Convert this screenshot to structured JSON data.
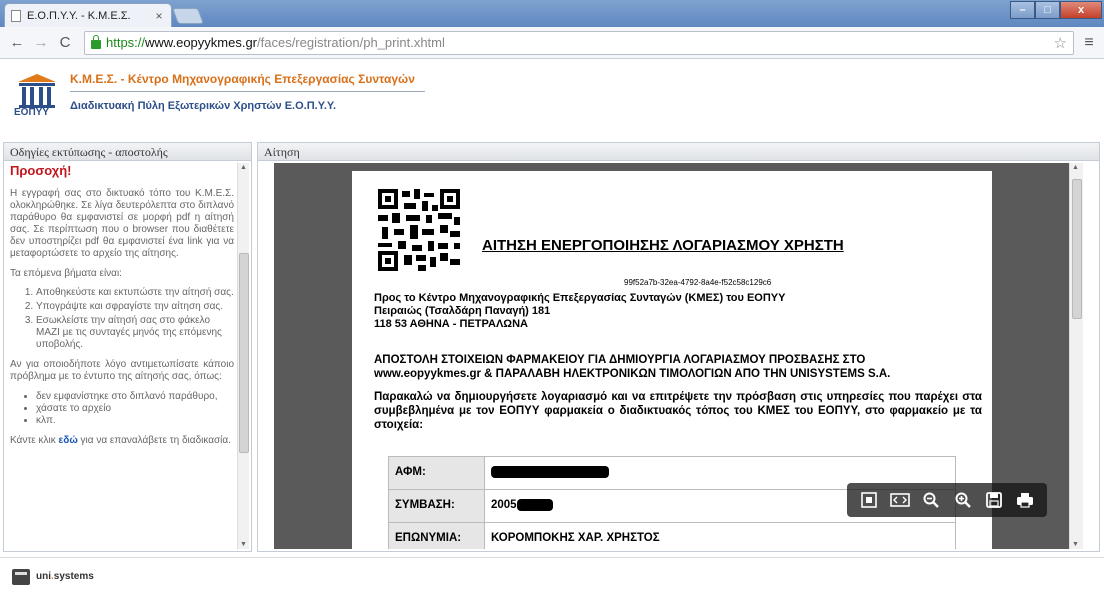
{
  "browser": {
    "tab_title": "Ε.Ο.Π.Υ.Υ. - Κ.Μ.Ε.Σ.",
    "tab_close": "×",
    "url_scheme": "https://",
    "url_host": "www.eopyykmes.gr",
    "url_path": "/faces/registration/ph_print.xhtml",
    "win_min": "–",
    "win_max": "□",
    "win_close": "x"
  },
  "header": {
    "logo_text": "ΕΟΠΥΥ",
    "title": "Κ.Μ.Ε.Σ. - Κέντρο Μηχανογραφικής Επεξεργασίας Συνταγών",
    "subtitle": "Διαδικτυακή Πύλη Εξωτερικών Χρηστών Ε.Ο.Π.Υ.Υ."
  },
  "left_panel": {
    "heading": "Οδηγίες εκτύπωσης - αποστολής",
    "warning": "Προσοχή!",
    "intro": "Η εγγραφή σας στο δικτυακό τόπο του Κ.Μ.Ε.Σ. ολοκληρώθηκε. Σε λίγα δευτερόλεπτα στο διπλανό παράθυρο θα εμφανιστεί σε μορφή pdf η αίτησή σας. Σε περίπτωση που ο browser που διαθέτετε δεν υποστηρίζει pdf θα εμφανιστεί ένα link για να μεταφορτώσετε το αρχείο της αίτησης.",
    "steps_title": "Τα επόμενα βήματα είναι:",
    "steps": [
      "Αποθηκεύστε και εκτυπώστε την αίτησή σας.",
      "Υπογράψτε και σφραγίστε την αίτηση σας.",
      "Εσωκλείστε την αίτησή σας στο φάκελο ΜΑΖΙ με τις συνταγές μηνός της επόμενης υποβολής."
    ],
    "problem_text": "Αν για οποιοδήποτε λόγο αντιμετωπίσατε κάποιο πρόβλημα με το έντυπο της αίτησής σας, όπως:",
    "problems": [
      "δεν εμφανίστηκε στο διπλανό παράθυρο,",
      "χάσατε το αρχείο",
      "κλπ."
    ],
    "retry_prefix": "Κάντε κλικ ",
    "retry_link": "εδώ",
    "retry_suffix": " για να επαναλάβετε τη διαδικασία."
  },
  "right_panel": {
    "heading": "Αίτηση"
  },
  "document": {
    "title": "ΑΙΤΗΣΗ ΕΝΕΡΓΟΠΟΙΗΣΗΣ ΛΟΓΑΡΙΑΣΜΟΥ ΧΡΗΣΤΗ",
    "uuid": "99f52a7b-32ea-4792-8a4e-f52c58c129c6",
    "address_line1": "Προς το Κέντρο Μηχανογραφικής Επεξεργασίας Συνταγών (ΚΜΕΣ) του ΕΟΠΥΥ",
    "address_line2": "Πειραιώς (Τσαλδάρη Παναγή) 181",
    "address_line3": "118 53 ΑΘΗΝΑ - ΠΕΤΡΑΛΩΝΑ",
    "subject_line1": "ΑΠΟΣΤΟΛΗ ΣΤΟΙΧΕΙΩΝ ΦΑΡΜΑΚΕΙΟΥ ΓΙΑ ΔΗΜΙΟΥΡΓΙΑ ΛΟΓΑΡΙΑΣΜΟΥ ΠΡΟΣΒΑΣΗΣ ΣΤΟ",
    "subject_line2": "www.eopyykmes.gr & ΠΑΡΑΛΑΒΗ ΗΛΕΚΤΡΟΝΙΚΩΝ ΤΙΜΟΛΟΓΙΩΝ ΑΠΟ ΤΗΝ UNISYSTEMS S.A.",
    "body": "Παρακαλώ να δημιουργήσετε λογαριασμό και να επιτρέψετε την πρόσβαση στις υπηρεσίες που παρέχει στα συμβεβλημένα με τον ΕΟΠΥΥ φαρμακεία ο διαδικτυακός τόπος του ΚΜΕΣ του ΕΟΠΥΥ, στο φαρμακείο με τα στοιχεία:",
    "field_afm_label": "ΑΦΜ:",
    "field_contract_label": "ΣΥΜΒΑΣΗ:",
    "field_contract_value": "2005",
    "field_third_label": "ΕΠΩΝΥΜΙΑ:",
    "field_third_value": "ΚΟΡΟΜΠΟΚΗΣ ΧΑΡ. ΧΡΗΣΤΟΣ"
  },
  "footer": {
    "brand_a": "uni",
    "brand_dot": ".",
    "brand_b": "systems"
  }
}
